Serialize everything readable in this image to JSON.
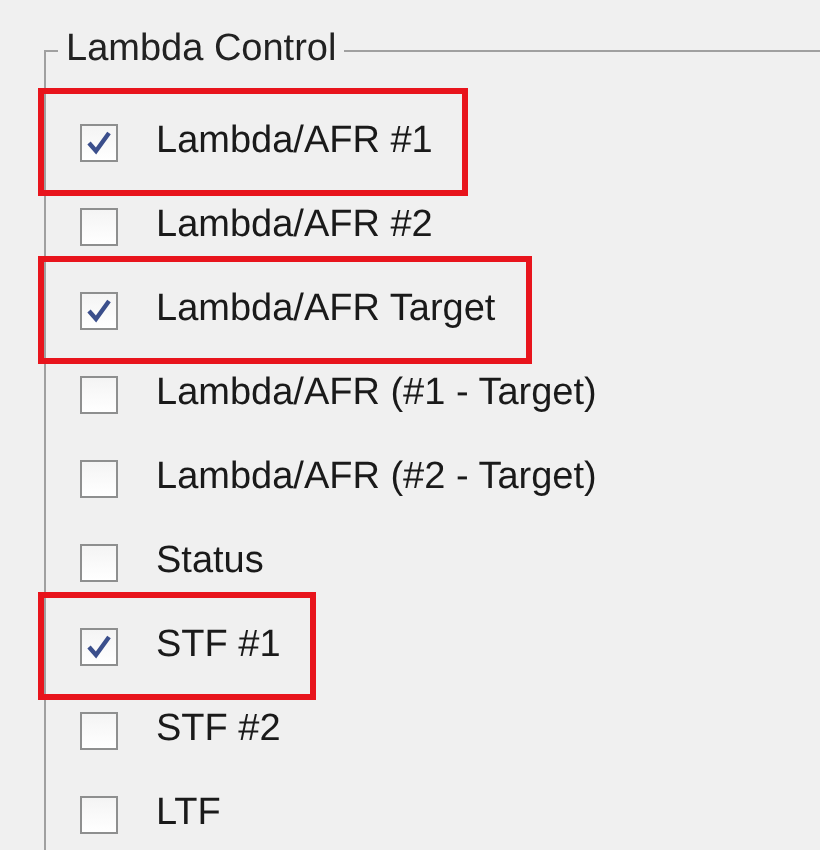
{
  "group": {
    "title": "Lambda Control",
    "items": [
      {
        "label": "Lambda/AFR #1",
        "checked": true,
        "highlighted": true
      },
      {
        "label": "Lambda/AFR #2",
        "checked": false,
        "highlighted": false
      },
      {
        "label": "Lambda/AFR Target",
        "checked": true,
        "highlighted": true
      },
      {
        "label": "Lambda/AFR (#1 - Target)",
        "checked": false,
        "highlighted": false
      },
      {
        "label": "Lambda/AFR (#2 - Target)",
        "checked": false,
        "highlighted": false
      },
      {
        "label": "Status",
        "checked": false,
        "highlighted": false
      },
      {
        "label": "STF #1",
        "checked": true,
        "highlighted": true
      },
      {
        "label": "STF #2",
        "checked": false,
        "highlighted": false
      },
      {
        "label": "LTF",
        "checked": false,
        "highlighted": false
      }
    ]
  }
}
